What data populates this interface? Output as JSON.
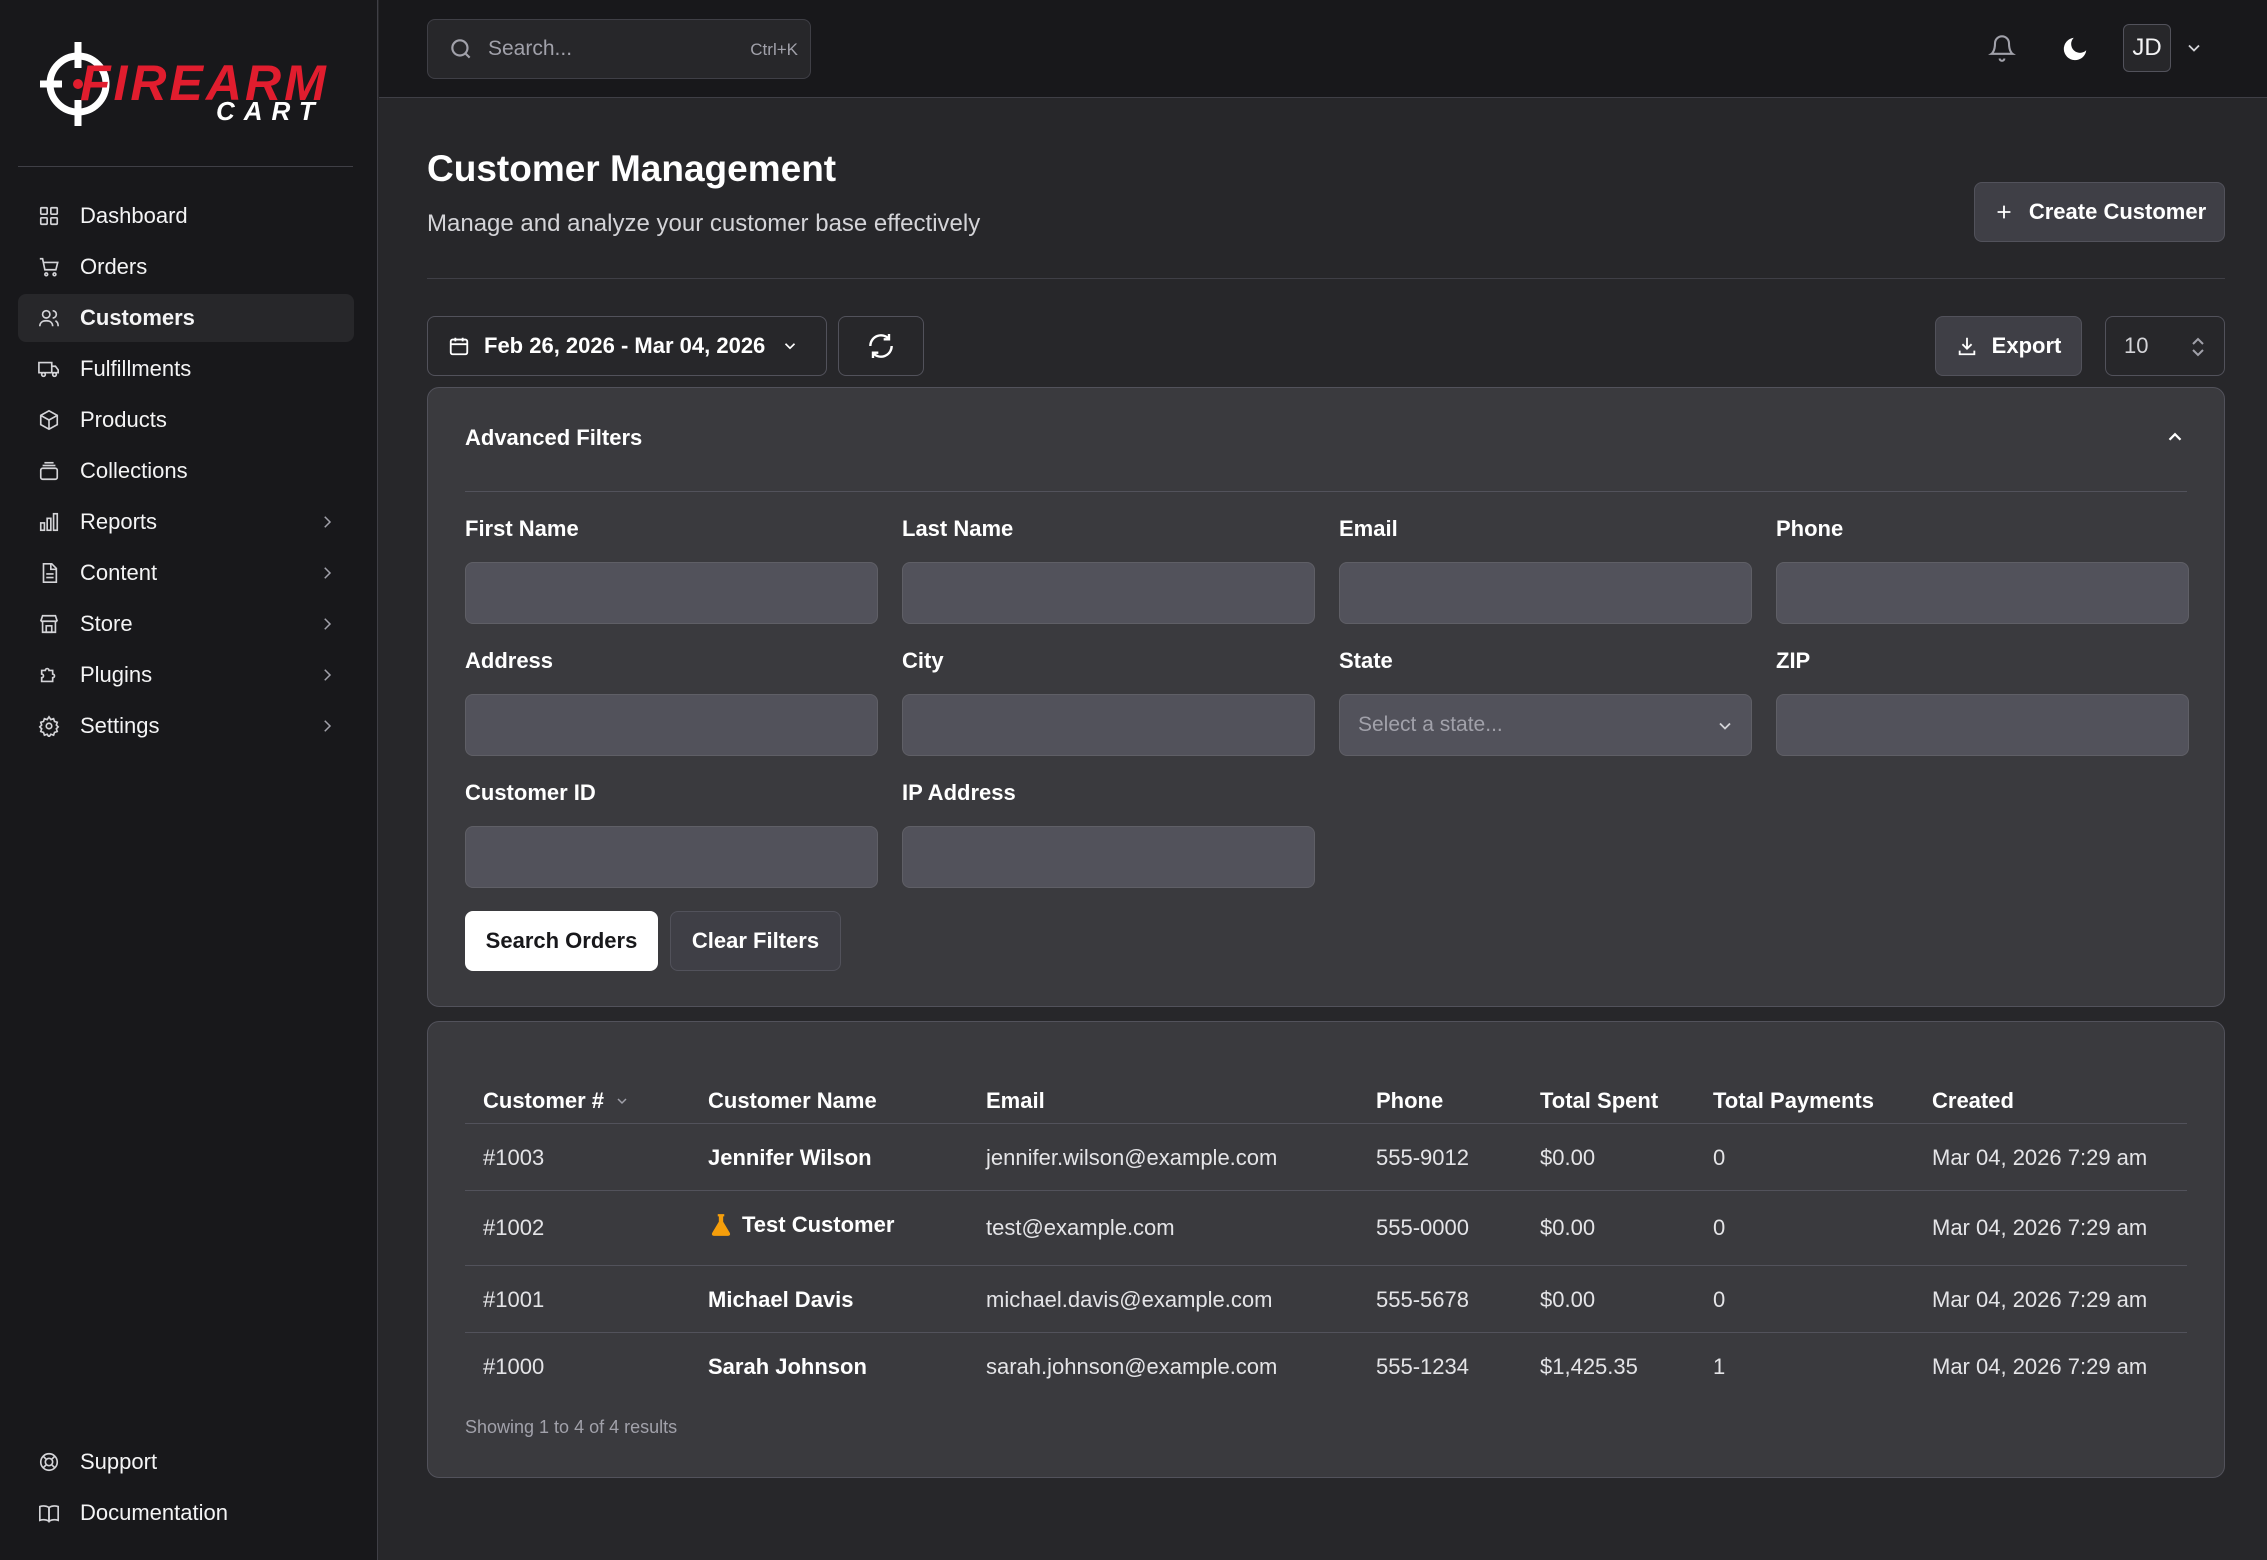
{
  "brand": {
    "main": "FIREARM",
    "sub": "CART",
    "accent": "#e11d2e"
  },
  "sidebar": {
    "items": [
      {
        "label": "Dashboard",
        "icon": "dashboard-icon"
      },
      {
        "label": "Orders",
        "icon": "cart-icon"
      },
      {
        "label": "Customers",
        "icon": "users-icon",
        "active": true
      },
      {
        "label": "Fulfillments",
        "icon": "truck-icon"
      },
      {
        "label": "Products",
        "icon": "box-icon"
      },
      {
        "label": "Collections",
        "icon": "collection-icon"
      },
      {
        "label": "Reports",
        "icon": "bar-chart-icon",
        "expandable": true
      },
      {
        "label": "Content",
        "icon": "file-icon",
        "expandable": true
      },
      {
        "label": "Store",
        "icon": "store-icon",
        "expandable": true
      },
      {
        "label": "Plugins",
        "icon": "puzzle-icon",
        "expandable": true
      },
      {
        "label": "Settings",
        "icon": "gear-icon",
        "expandable": true
      }
    ],
    "bottom": [
      {
        "label": "Support",
        "icon": "lifebuoy-icon"
      },
      {
        "label": "Documentation",
        "icon": "book-icon"
      }
    ]
  },
  "topbar": {
    "search_placeholder": "Search...",
    "search_shortcut": "Ctrl+K",
    "avatar_initials": "JD"
  },
  "header": {
    "title": "Customer Management",
    "subtitle": "Manage and analyze your customer base effectively",
    "create_label": "Create Customer"
  },
  "toolbar": {
    "date_range": "Feb 26, 2026 - Mar 04, 2026",
    "export_label": "Export",
    "page_size": "10"
  },
  "filters": {
    "title": "Advanced Filters",
    "fields": {
      "first_name": "First Name",
      "last_name": "Last Name",
      "email": "Email",
      "phone": "Phone",
      "address": "Address",
      "city": "City",
      "state": "State",
      "zip": "ZIP",
      "customer_id": "Customer ID",
      "ip_address": "IP Address"
    },
    "state_placeholder": "Select a state...",
    "search_label": "Search Orders",
    "clear_label": "Clear Filters"
  },
  "table": {
    "columns": [
      "Customer #",
      "Customer Name",
      "Email",
      "Phone",
      "Total Spent",
      "Total Payments",
      "Created"
    ],
    "rows": [
      {
        "id": "#1003",
        "name": "Jennifer Wilson",
        "email": "jennifer.wilson@example.com",
        "phone": "555-9012",
        "spent": "$0.00",
        "payments": "0",
        "created": "Mar 04, 2026 7:29 am"
      },
      {
        "id": "#1002",
        "name": "Test Customer",
        "test": true,
        "email": "test@example.com",
        "phone": "555-0000",
        "spent": "$0.00",
        "payments": "0",
        "created": "Mar 04, 2026 7:29 am"
      },
      {
        "id": "#1001",
        "name": "Michael Davis",
        "email": "michael.davis@example.com",
        "phone": "555-5678",
        "spent": "$0.00",
        "payments": "0",
        "created": "Mar 04, 2026 7:29 am"
      },
      {
        "id": "#1000",
        "name": "Sarah Johnson",
        "email": "sarah.johnson@example.com",
        "phone": "555-1234",
        "spent": "$1,425.35",
        "payments": "1",
        "created": "Mar 04, 2026 7:29 am"
      }
    ],
    "footer": "Showing 1 to 4 of 4 results"
  }
}
